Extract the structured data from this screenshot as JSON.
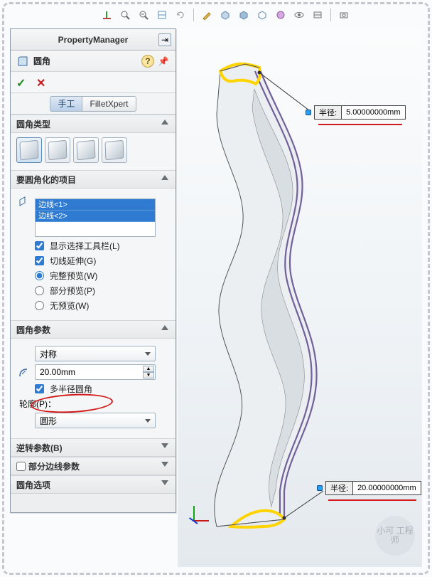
{
  "pm": {
    "title": "PropertyManager",
    "feature_name": "圆角",
    "ok_symbol": "✓",
    "cancel_symbol": "✕",
    "help_symbol": "?",
    "pin_symbol": "⇥"
  },
  "mode_tabs": {
    "manual": "手工",
    "xpert": "FilletXpert"
  },
  "sections": {
    "type": {
      "title": "圆角类型"
    },
    "items": {
      "title": "要圆角化的项目",
      "selected": [
        "边线<1>",
        "边线<2>"
      ],
      "show_toolbar": "显示选择工具栏(L)",
      "tangent_prop": "切线延伸(G)",
      "preview_full": "完整预览(W)",
      "preview_partial": "部分预览(P)",
      "preview_none": "无预览(W)"
    },
    "params": {
      "title": "圆角参数",
      "symmetry": "对称",
      "radius_value": "20.00mm",
      "multi_radius": "多半径圆角",
      "profile_label": "轮廓(P)：",
      "profile_value": "圆形"
    },
    "reverse": {
      "title": "逆转参数(B)"
    },
    "partial_edge": {
      "title": " 部分边线参数"
    },
    "options": {
      "title": "圆角选项"
    }
  },
  "callouts": {
    "radius_label": "半径:",
    "r1_value": "5.00000000mm",
    "r2_value": "20.00000000mm"
  },
  "toolbar_items": [
    "axis-icon",
    "magnify-icon",
    "magnify-icon",
    "section-icon",
    "lasso-icon",
    "sep",
    "edit-icon",
    "cube-iso-icon",
    "cube-shaded-icon",
    "cube-wire-icon",
    "palette-icon",
    "hide-icon",
    "layers-icon",
    "sep",
    "capture-icon"
  ],
  "watermark": "小可\n工程师"
}
